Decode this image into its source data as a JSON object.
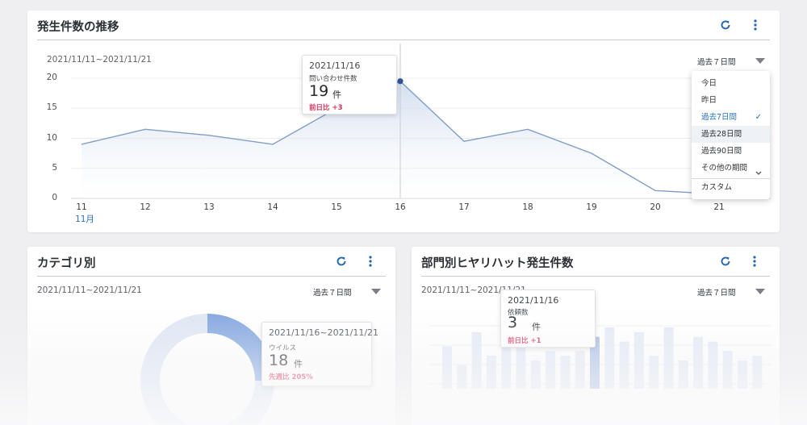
{
  "trend": {
    "title": "発生件数の推移",
    "range": "2021/11/11~2021/11/21",
    "period": "過去７日間",
    "month_label": "11月",
    "menu": [
      {
        "label": "今日",
        "state": ""
      },
      {
        "label": "昨日",
        "state": ""
      },
      {
        "label": "過去7日間",
        "state": "selected"
      },
      {
        "label": "過去28日間",
        "state": "hover"
      },
      {
        "label": "過去90日間",
        "state": ""
      },
      {
        "label": "その他の期間",
        "state": "expand"
      },
      {
        "label": "カスタム",
        "state": ""
      }
    ],
    "tooltip": {
      "date": "2021/11/16",
      "label": "問い合わせ件数",
      "value": "19",
      "unit": "件",
      "diff": "前日比 +3"
    },
    "colors": {
      "line": "#7f9dc6",
      "point": "#2f5597",
      "accent": "#2a6fc0",
      "diff": "#d8325b"
    },
    "chart_data": {
      "type": "area",
      "x": [
        "11",
        "12",
        "13",
        "14",
        "15",
        "16",
        "17",
        "18",
        "19",
        "20",
        "21"
      ],
      "yticks": [
        "0",
        "5",
        "10",
        "15",
        "20"
      ],
      "ylim": [
        0,
        20
      ],
      "values": [
        9,
        11.5,
        10.5,
        9,
        15,
        19.5,
        9.5,
        11.5,
        7.5,
        1.3,
        0.7
      ],
      "highlight_index": 5
    }
  },
  "category": {
    "title": "カテゴリ別",
    "range": "2021/11/11~2021/11/21",
    "period": "過去７日間",
    "tooltip": {
      "date": "2021/11/16~2021/11/21",
      "label": "ウイルス",
      "value": "18",
      "unit": "件",
      "diff": "先週比 205%"
    }
  },
  "department": {
    "title": "部門別ヒヤリハット発生件数",
    "range": "2021/11/11~2021/11/21",
    "period": "過去７日間",
    "tooltip": {
      "date": "2021/11/16",
      "label": "依頼数",
      "value": "3",
      "unit": "件",
      "diff": "前日比 +1"
    },
    "chart_data": {
      "type": "bar",
      "values": [
        9,
        5,
        12,
        7,
        10,
        9,
        6,
        8,
        7,
        8,
        11,
        13,
        10,
        12,
        7,
        13,
        6,
        11,
        10,
        8,
        6,
        7
      ]
    }
  }
}
